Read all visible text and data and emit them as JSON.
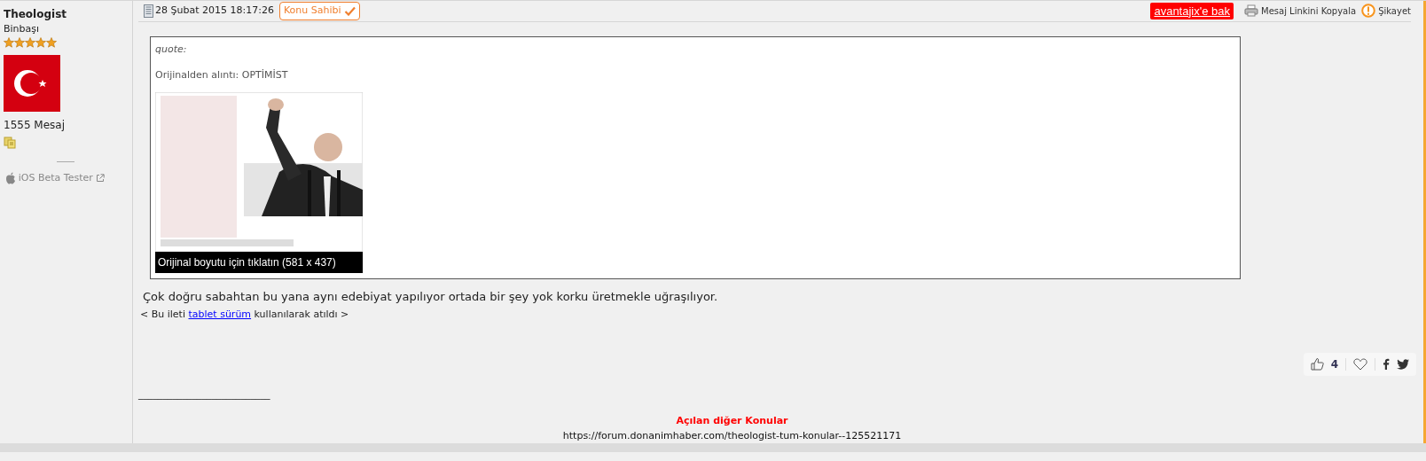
{
  "user": {
    "name": "Theologist",
    "rank": "Binbaşı",
    "stars": 5,
    "post_count": "1555 Mesaj",
    "badge": "iOS Beta Tester"
  },
  "post": {
    "date": "28 Şubat 2015 18:17:26",
    "owner_tag": "Konu Sahibi",
    "ad_label": "avantajix'e bak",
    "copy_link": "Mesaj Linkini Kopyala",
    "report": "Şikayet",
    "quote": {
      "label": "quote:",
      "source": "Orijinalden alıntı: OPTİMİST",
      "image": {
        "kind": "picture",
        "caption": "Orijinal boyutu için tıklatın (581 x 437)"
      }
    },
    "body": "Çok doğru sabahtan bu yana aynı edebiyat yapılıyor ortada bir şey yok korku üretmekle uğraşılıyor.",
    "footer_note": {
      "before": "< Bu ileti",
      "link": "tablet sürüm",
      "after": "kullanılarak atıldı >"
    },
    "likes": "4",
    "signature": {
      "rule": "___________________________",
      "heading": "Açılan diğer Konular",
      "url": "https://forum.donanimhaber.com/theologist-tum-konular--125521171"
    }
  }
}
